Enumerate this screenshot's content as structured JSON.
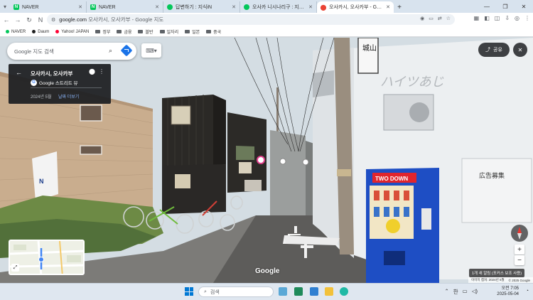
{
  "browser": {
    "tabs": [
      {
        "label": "NAVER",
        "favicon": "naver-icon",
        "active": false
      },
      {
        "label": "NAVER",
        "favicon": "naver-icon",
        "active": false
      },
      {
        "label": "답변하기 : 지식iN",
        "favicon": "kin-icon",
        "active": false
      },
      {
        "label": "오사카 니시나리구 : 지식iN",
        "favicon": "kin-icon",
        "active": false
      },
      {
        "label": "오사카시, 오사카부 - Google",
        "favicon": "maps-icon",
        "active": true
      }
    ],
    "new_tab_label": "+",
    "url_domain": "google.com",
    "url_rest": "오사카시, 오사카부 - Google 지도",
    "bookmarks": [
      {
        "label": "NAVER",
        "color": "#03c75a"
      },
      {
        "label": "Daum",
        "color": "#1f1f1f"
      },
      {
        "label": "Yahoo! JAPAN",
        "color": "#ff0033"
      },
      {
        "label": "정부"
      },
      {
        "label": "금융"
      },
      {
        "label": "블반"
      },
      {
        "label": "일자리"
      },
      {
        "label": "일본"
      },
      {
        "label": "중국"
      }
    ]
  },
  "maps": {
    "search_placeholder": "Google 지도 검색",
    "place_title": "오사카시, 오사카부",
    "street_view_label": "Google 스트리트 뷰",
    "capture_date": "2024년 5월",
    "more_dates": "날짜 더보기",
    "share_label": "공유",
    "google_logo": "Google",
    "attribution_date": "이미지 캡처: 2024년 5월",
    "attribution_copy": "© 2025 Google",
    "tooltip": "1개 새 알림 (포커스 보조 사용)",
    "zoom_in": "+",
    "zoom_out": "−"
  },
  "scene_text": {
    "vending_brand": "TWO DOWN",
    "vertical_sign": "城山",
    "right_sign": "広告募集",
    "wall_script": "ハイツあじ"
  },
  "taskbar": {
    "search_placeholder": "검색",
    "ime": "한",
    "time": "오전 7:05",
    "date": "2025-05-04"
  }
}
